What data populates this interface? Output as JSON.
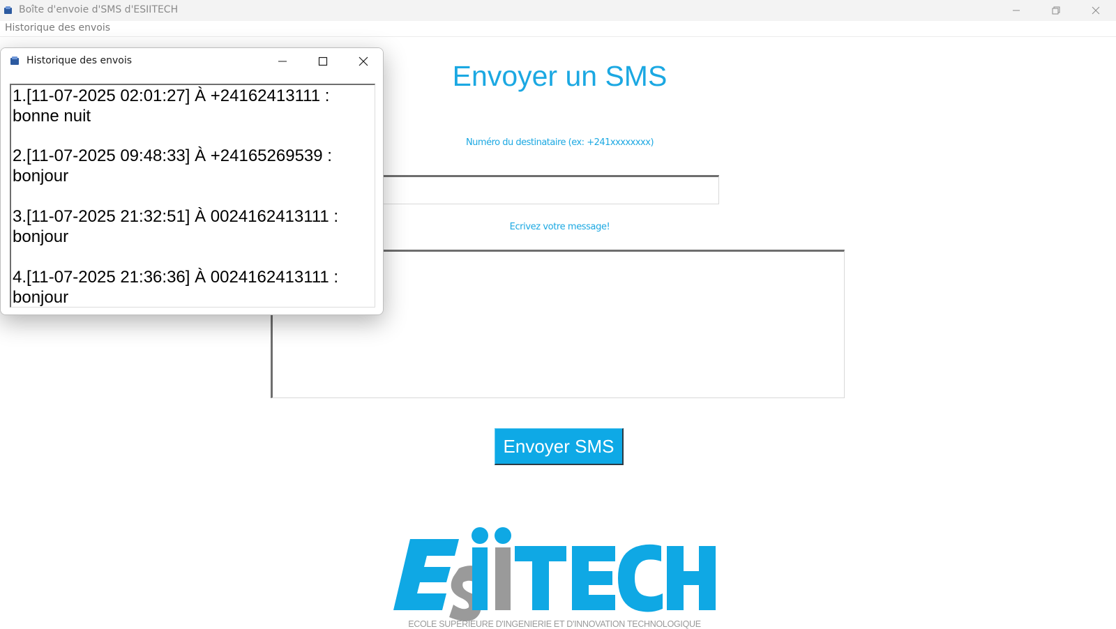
{
  "window": {
    "title": "Boîte d'envoie d'SMS d'ESIITECH",
    "controls": [
      "minimize",
      "restore",
      "close"
    ]
  },
  "menubar": {
    "items": [
      {
        "label": "Historique des envois"
      }
    ]
  },
  "form": {
    "heading": "Envoyer un SMS",
    "number_label": "Numéro du destinataire (ex: +241xxxxxxxx)",
    "number_value": "",
    "message_label": "Ecrivez votre message!",
    "message_value": "",
    "send_button": "Envoyer SMS"
  },
  "logo": {
    "text_main": "ESIITECH",
    "tagline": "ECOLE SUPERIEURE D'INGENIERIE ET D'INNOVATION TECHNOLOGIQUE"
  },
  "history_window": {
    "title": "Historique des envois",
    "entries": [
      {
        "line1": "1.[11-07-2025  02:01:27] À +24162413111 :",
        "line2": "bonne nuit"
      },
      {
        "line1": "2.[11-07-2025  09:48:33] À +24165269539 :",
        "line2": "bonjour"
      },
      {
        "line1": "3.[11-07-2025  21:32:51] À 0024162413111 :",
        "line2": "bonjour"
      },
      {
        "line1": "4.[11-07-2025  21:36:36] À 0024162413111 :",
        "line2": "bonjour"
      }
    ]
  },
  "colors": {
    "accent": "#1ba8e2",
    "button": "#0ea9e6",
    "logo_blue": "#0fa8e4",
    "logo_gray": "#9a9a9a"
  },
  "icons": {
    "app": "app-icon",
    "minimize": "minimize-icon",
    "restore": "restore-icon",
    "maximize": "maximize-icon",
    "close": "close-icon"
  }
}
